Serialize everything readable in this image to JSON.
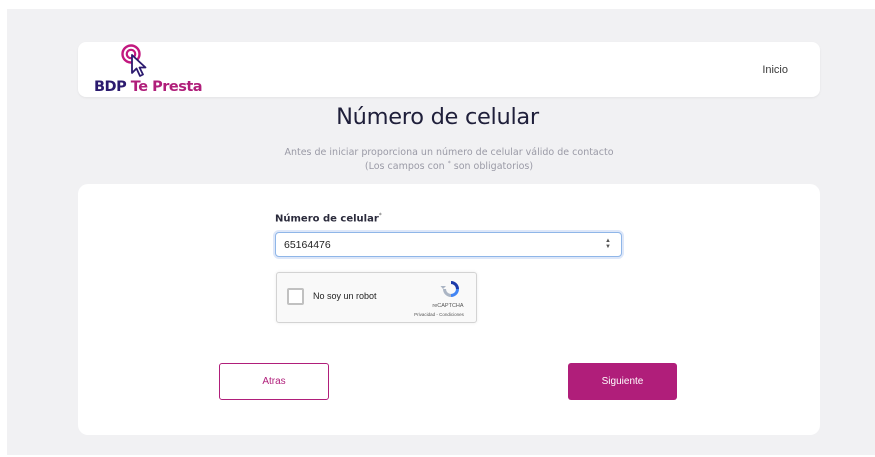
{
  "header": {
    "logo": {
      "word1": "BDP",
      "word2": "Te Presta"
    },
    "nav_inicio": "Inicio"
  },
  "page_title": "Número de celular",
  "subtitle": {
    "line1": "Antes de iniciar proporciona un número de celular válido de contacto",
    "line2_prefix": "(Los campos con",
    "star": "*",
    "line2_suffix": "son obligatorios)"
  },
  "form": {
    "phone_label": "Número de celular",
    "required_mark": "*",
    "phone_value": "65164476"
  },
  "recaptcha": {
    "label": "No soy un robot",
    "brand": "reCAPTCHA",
    "links": "Privacidad - Condiciones"
  },
  "buttons": {
    "back": "Atras",
    "next": "Siguiente"
  },
  "colors": {
    "brand_magenta": "#b01e7a",
    "brand_navy": "#2b1a6e",
    "page_bg": "#f1f1f3"
  },
  "icons": {
    "logo": "cursor-click-icon",
    "recaptcha": "recaptcha-logo-icon",
    "spinner": "number-spinner-icon"
  }
}
